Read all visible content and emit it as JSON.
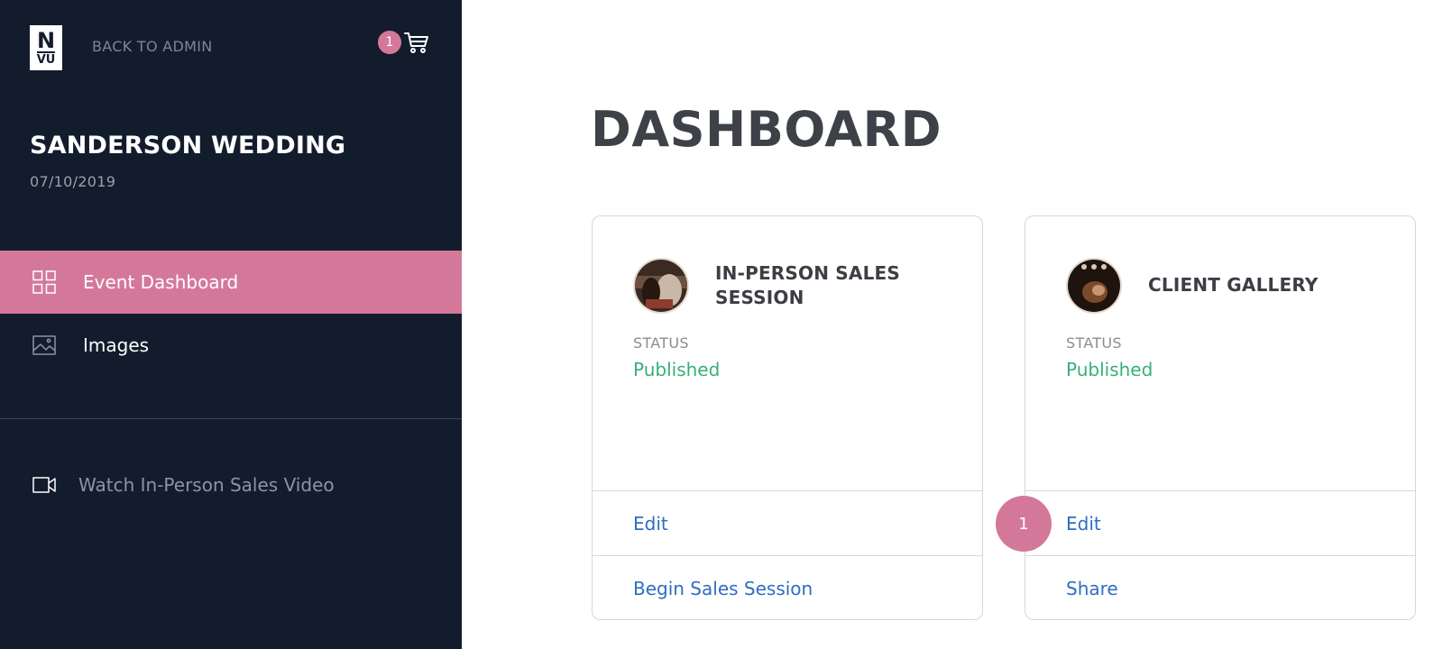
{
  "sidebar": {
    "logo": {
      "line1": "N",
      "line2": "VU"
    },
    "back_label": "BACK TO ADMIN",
    "cart": {
      "count": "1",
      "icon": "cart-icon"
    },
    "event": {
      "title": "SANDERSON WEDDING",
      "date": "07/10/2019"
    },
    "nav": [
      {
        "label": "Event Dashboard",
        "icon": "grid-icon",
        "active": true
      },
      {
        "label": "Images",
        "icon": "image-icon",
        "active": false
      }
    ],
    "video_link": {
      "label": "Watch In-Person Sales Video",
      "icon": "video-icon"
    }
  },
  "main": {
    "title": "DASHBOARD",
    "cards": [
      {
        "title": "IN-PERSON SALES SESSION",
        "status_label": "STATUS",
        "status_value": "Published",
        "actions": [
          "Edit",
          "Begin Sales Session"
        ]
      },
      {
        "title": "CLIENT GALLERY",
        "status_label": "STATUS",
        "status_value": "Published",
        "actions": [
          "Edit",
          "Share"
        ]
      }
    ],
    "step_badge": "1"
  },
  "colors": {
    "sidebar_bg": "#121c2d",
    "accent_pink": "#d4789a",
    "status_green": "#3aae7a",
    "link_blue": "#2f6dc2"
  }
}
